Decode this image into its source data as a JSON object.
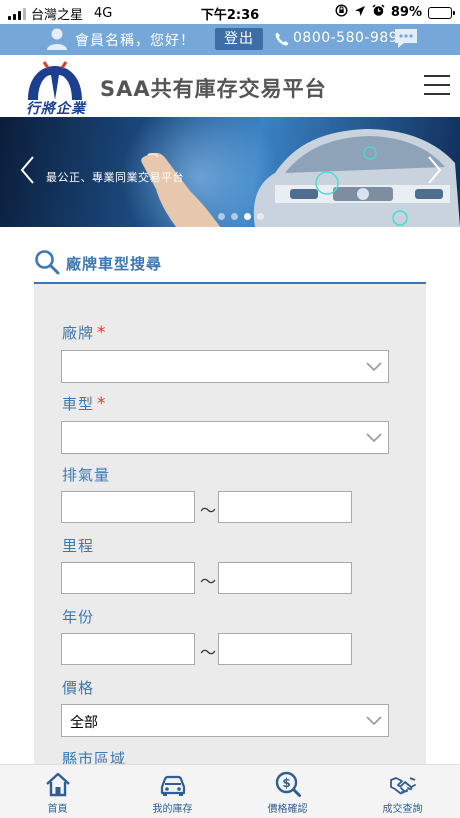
{
  "status_bar": {
    "carrier": "台灣之星",
    "network": "4G",
    "time": "下午2:36",
    "battery": "89%",
    "battery_level": 0.89
  },
  "member_bar": {
    "greeting": "會員名稱，您好！",
    "logout_label": "登出",
    "phone": "0800-580-989"
  },
  "header": {
    "logo_text": "行將企業",
    "title": "SAA共有庫存交易平台"
  },
  "banner": {
    "slogan": "最公正、專業同業交易平台",
    "slide_count": 4,
    "active_slide": 3
  },
  "search": {
    "title": "廠牌車型搜尋",
    "fields": {
      "brand": {
        "label": "廠牌",
        "required": true,
        "value": ""
      },
      "model": {
        "label": "車型",
        "required": true,
        "value": ""
      },
      "displacement": {
        "label": "排氣量",
        "from": "",
        "to": ""
      },
      "mileage": {
        "label": "里程",
        "from": "",
        "to": ""
      },
      "year": {
        "label": "年份",
        "from": "",
        "to": ""
      },
      "price": {
        "label": "價格",
        "value": "全部"
      },
      "region": {
        "label": "縣市區域"
      }
    },
    "required_mark": "*",
    "range_separator": "～"
  },
  "tabs": [
    {
      "label": "首頁",
      "icon": "home-icon"
    },
    {
      "label": "我的庫存",
      "icon": "car-icon"
    },
    {
      "label": "價格確認",
      "icon": "price-check-icon"
    },
    {
      "label": "成交查詢",
      "icon": "handshake-icon"
    }
  ],
  "colors": {
    "member_bar": "#75a7d8",
    "accent": "#3f78b0",
    "required": "#e23a2e",
    "panel": "#ebebeb"
  }
}
